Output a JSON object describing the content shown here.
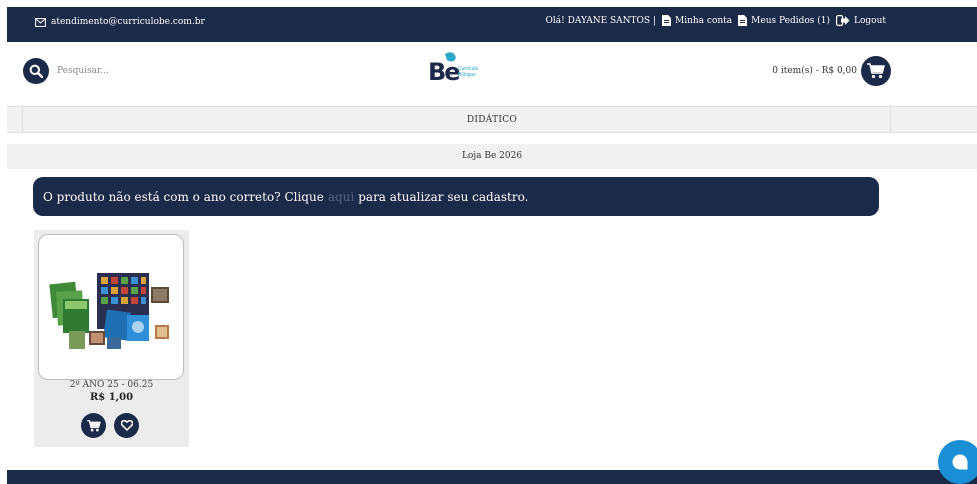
{
  "topbar": {
    "email": "atendimento@curriculobe.com.br",
    "greeting": "Olá! DAYANE SANTOS |",
    "account": "Minha conta",
    "orders": "Meus Pedidos (1)",
    "logout": "Logout"
  },
  "header": {
    "search_placeholder": "Pesquisar...",
    "logo_text_line1": "Currículo",
    "logo_text_line2": "Bilíngue",
    "cart_summary": "0 item(s) - R$ 0,00"
  },
  "nav": {
    "items": [
      {
        "label": "DIDÁTICO"
      }
    ]
  },
  "store": {
    "title": "Loja Be 2026"
  },
  "alert": {
    "text_before": "O produto não está com o ano correto? Clique",
    "link": "aqui",
    "text_after": "para atualizar seu cadastro."
  },
  "products": [
    {
      "name": "2º ANO 25 - 06.25",
      "price": "R$ 1,00"
    }
  ],
  "colors": {
    "primary": "#1c2a4a",
    "chat": "#1a8fd6",
    "logo_accent": "#2aa7c9"
  },
  "icons": [
    "mail-icon",
    "document-icon",
    "logout-icon",
    "search-icon",
    "cart-icon",
    "heart-icon",
    "chat-icon"
  ]
}
